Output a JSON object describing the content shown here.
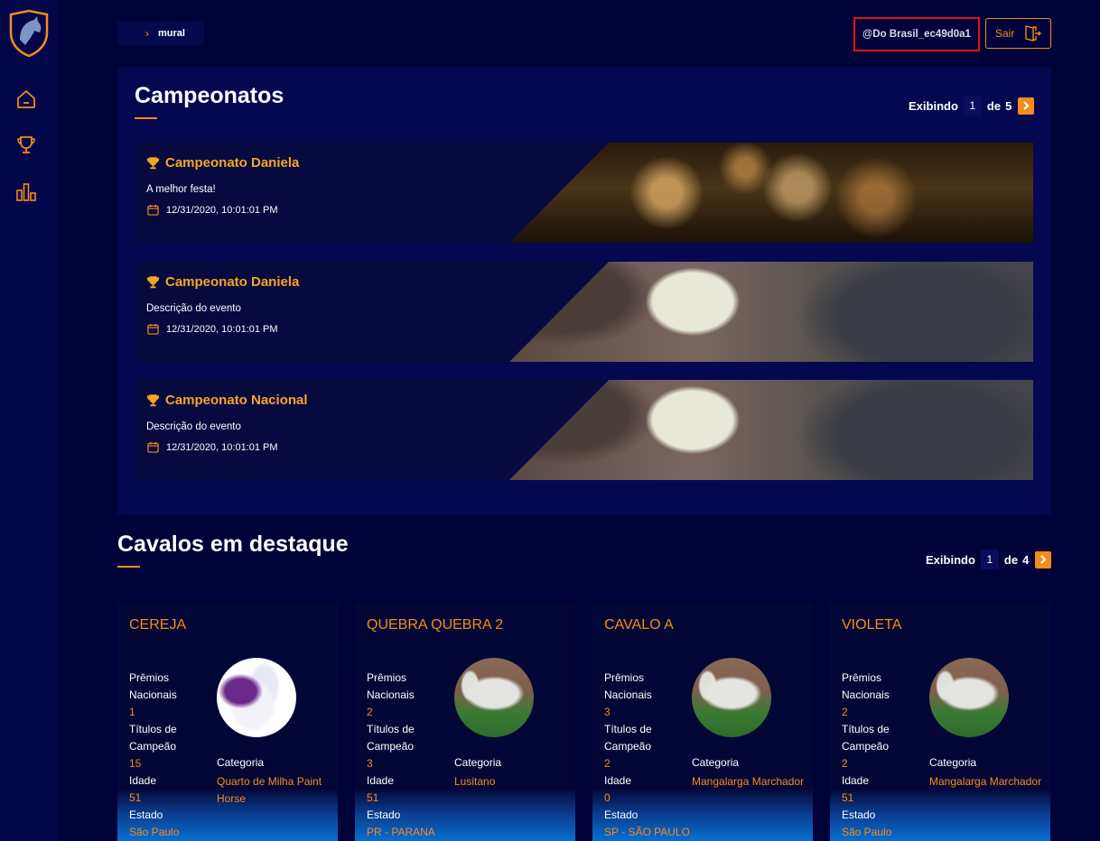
{
  "breadcrumb": {
    "separator": "›",
    "current": "mural"
  },
  "user": {
    "handle": "@Do Brasil_ec49d0a1"
  },
  "logout": {
    "label": "Sair"
  },
  "sidebar": {
    "items": [
      "home-icon",
      "trophy-icon",
      "bar-chart-icon"
    ]
  },
  "championships": {
    "title": "Campeonatos",
    "pager": {
      "showing_label": "Exibindo",
      "current": "1",
      "of_label": "de",
      "total": "5"
    },
    "items": [
      {
        "name": "Campeonato Daniela",
        "description": "A melhor festa!",
        "date": "12/31/2020, 10:01:01 PM"
      },
      {
        "name": "Campeonato Daniela",
        "description": "Descrição do evento",
        "date": "12/31/2020, 10:01:01 PM"
      },
      {
        "name": "Campeonato Nacional",
        "description": "Descrição do evento",
        "date": "12/31/2020, 10:01:01 PM"
      }
    ]
  },
  "horses": {
    "title": "Cavalos em destaque",
    "pager": {
      "showing_label": "Exibindo",
      "current": "1",
      "of_label": "de",
      "total": "4"
    },
    "labels": {
      "premios_1": "Prêmios",
      "premios_2": "Nacionais",
      "titulos_1": "Títulos de",
      "titulos_2": "Campeão",
      "idade": "Idade",
      "estado": "Estado",
      "categoria": "Categoria"
    },
    "items": [
      {
        "name": "CEREJA",
        "premios": "1",
        "titulos": "15",
        "idade": "51",
        "estado": "São Paulo",
        "categoria": "Quarto de Milha Paint Horse"
      },
      {
        "name": "QUEBRA QUEBRA 2",
        "premios": "2",
        "titulos": "3",
        "idade": "51",
        "estado": "PR - PARANA",
        "categoria": "Lusitano"
      },
      {
        "name": "CAVALO A",
        "premios": "3",
        "titulos": "2",
        "idade": "0",
        "estado": "SP - SÃO PAULO",
        "categoria": "Mangalarga Marchador"
      },
      {
        "name": "VIOLETA",
        "premios": "2",
        "titulos": "2",
        "idade": "51",
        "estado": "São Paulo",
        "categoria": "Mangalarga Marchador"
      }
    ]
  },
  "colors": {
    "accent": "#f28c1c",
    "gold": "#f5a623",
    "background": "#02023a",
    "highlight_border": "#e01414"
  }
}
